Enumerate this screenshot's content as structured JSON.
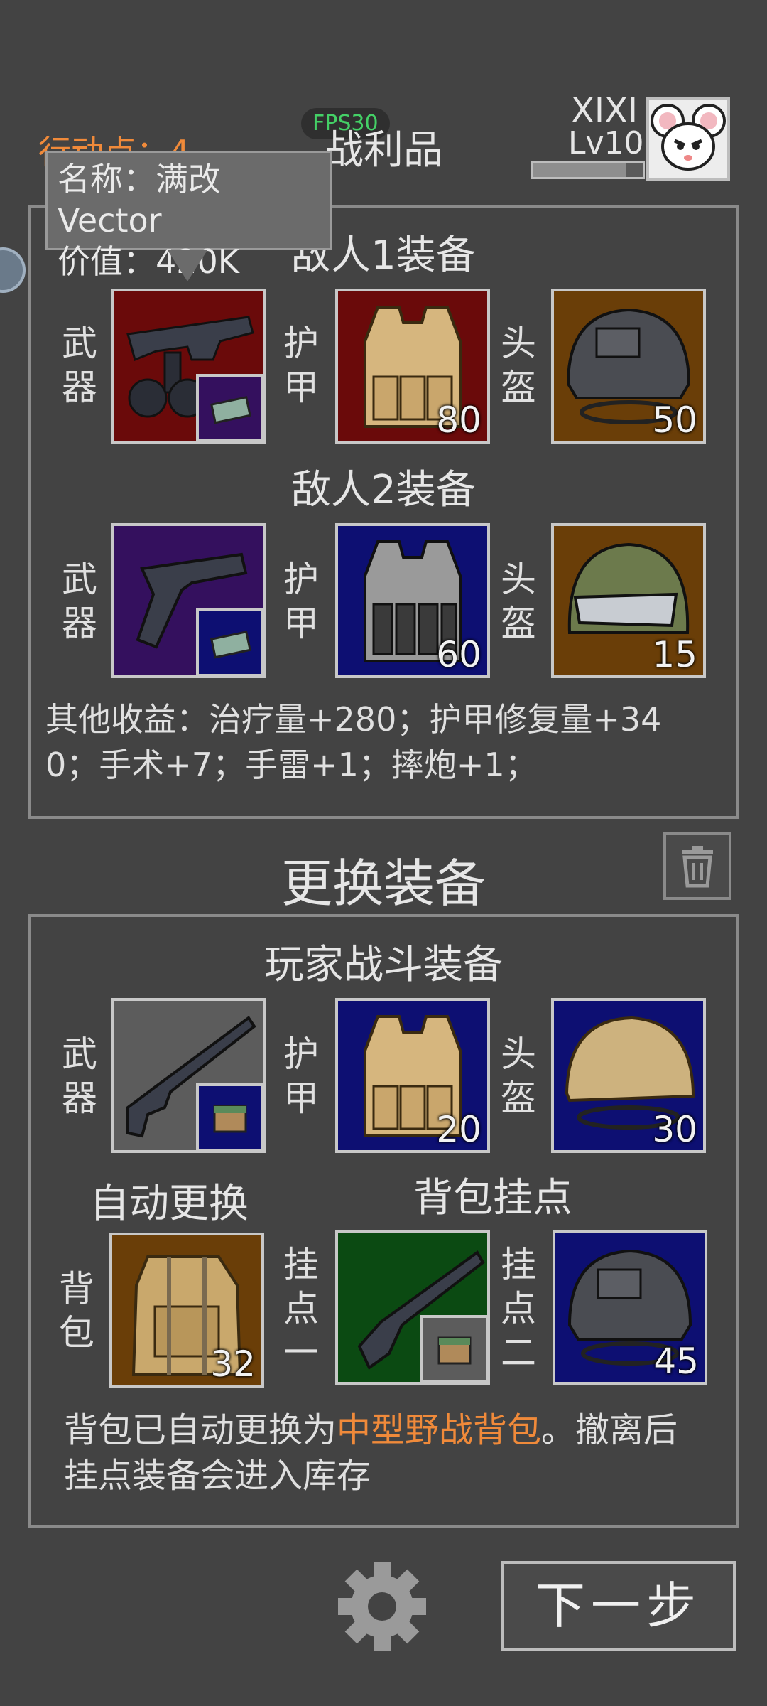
{
  "header": {
    "action_points": "行动点：4",
    "fps": "FPS30",
    "title": "战利品",
    "player_name": "XIXI",
    "player_level": "Lv10",
    "xp_progress": 0.85
  },
  "tooltip": {
    "name_line": "名称：满改Vector",
    "value_line": "价值：420K"
  },
  "loot": {
    "enemy1_title": "敌人1装备",
    "enemy2_title": "敌人2装备",
    "weapon_label": [
      "武",
      "器"
    ],
    "armor_label": [
      "护",
      "甲"
    ],
    "helmet_label": [
      "头",
      "盔"
    ],
    "enemy1": {
      "armor_value": "80",
      "helmet_value": "50"
    },
    "enemy2": {
      "armor_value": "60",
      "helmet_value": "15"
    },
    "other_income_line1": "其他收益：治疗量+280；护甲修复量+34",
    "other_income_line2": "0；手术+7；手雷+1；摔炮+1；"
  },
  "change": {
    "title": "更换装备",
    "trash_icon": "trash-icon"
  },
  "player": {
    "title": "玩家战斗装备",
    "armor_value": "20",
    "helmet_value": "30",
    "auto_replace": "自动更换",
    "backpack_mounts": "背包挂点",
    "backpack_label": [
      "背",
      "包"
    ],
    "mount1_label": [
      "挂",
      "点",
      "一"
    ],
    "mount2_label": [
      "挂",
      "点",
      "二"
    ],
    "backpack_value": "32",
    "mount2_value": "45",
    "notice_prefix": "背包已自动更换为",
    "notice_highlight": "中型野战背包",
    "notice_suffix": "。撤离后",
    "notice_line2": "挂点装备会进入库存"
  },
  "footer": {
    "settings_icon": "gear-icon",
    "next_button": "下一步"
  },
  "colors": {
    "background": "#434343",
    "accent_orange": "#f08a3a",
    "fps_green": "#44d066"
  }
}
